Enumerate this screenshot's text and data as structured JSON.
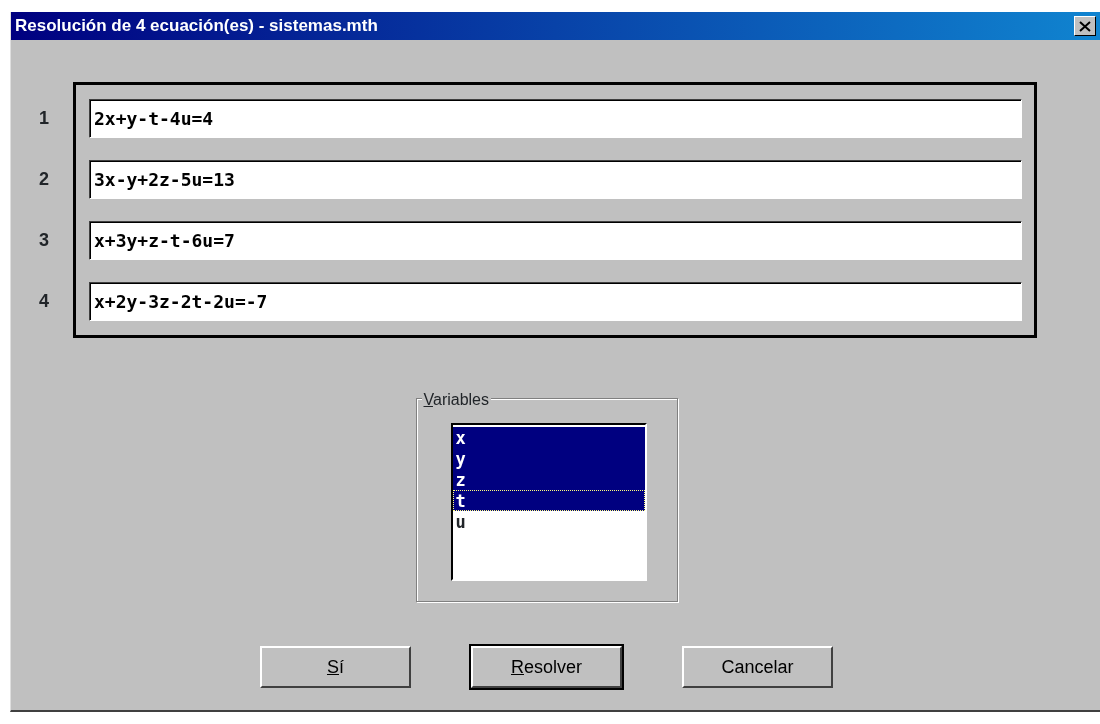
{
  "window": {
    "title": "Resolución de 4 ecuación(es) - sistemas.mth"
  },
  "equations": [
    {
      "number": "1",
      "value": "2x+y-t-4u=4"
    },
    {
      "number": "2",
      "value": "3x-y+2z-5u=13"
    },
    {
      "number": "3",
      "value": "x+3y+z-t-6u=7"
    },
    {
      "number": "4",
      "value": "x+2y-3z-2t-2u=-7"
    }
  ],
  "variables": {
    "label": "Variables",
    "mnemonic": true,
    "items": [
      {
        "label": "x",
        "selected": true,
        "focused": false
      },
      {
        "label": "y",
        "selected": true,
        "focused": false
      },
      {
        "label": "z",
        "selected": true,
        "focused": false
      },
      {
        "label": "t",
        "selected": true,
        "focused": true
      },
      {
        "label": "u",
        "selected": false,
        "focused": false
      }
    ]
  },
  "buttons": [
    {
      "label": "Sí",
      "mnemonic": true,
      "default": false
    },
    {
      "label": "Resolver",
      "mnemonic": true,
      "default": true
    },
    {
      "label": "Cancelar",
      "mnemonic": false,
      "default": false
    }
  ]
}
